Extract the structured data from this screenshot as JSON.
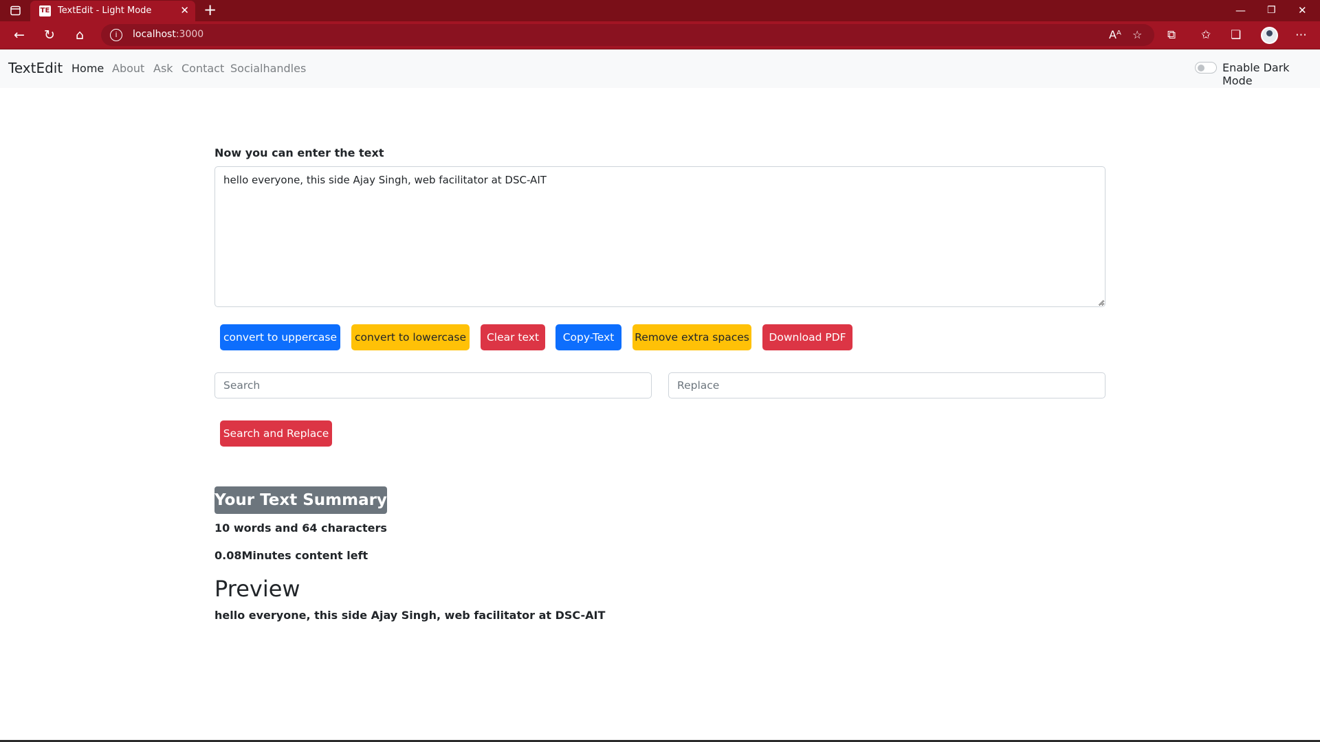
{
  "browser": {
    "tab_title": "TextEdit - Light Mode",
    "favicon_text": "TE",
    "url_host": "localhost",
    "url_port": ":3000"
  },
  "navbar": {
    "brand": "TextEdit",
    "links": [
      "Home",
      "About",
      "Ask",
      "Contact",
      "Socialhandles"
    ],
    "dark_mode_label": "Enable Dark Mode",
    "dark_mode_enabled": false
  },
  "editor": {
    "heading": "Now you can enter the text",
    "text": "hello everyone, this side Ajay Singh, web facilitator at DSC-AIT"
  },
  "actions": {
    "uppercase": "convert to uppercase",
    "lowercase": "convert to lowercase",
    "clear": "Clear text",
    "copy": "Copy-Text",
    "remove_spaces": "Remove extra spaces",
    "download_pdf": "Download PDF"
  },
  "search_replace": {
    "search_placeholder": "Search",
    "replace_placeholder": "Replace",
    "button": "Search and Replace"
  },
  "summary": {
    "heading": "Your Text Summary",
    "word_char_count": "10 words and 64 characters",
    "reading_time": "0.08Minutes content left"
  },
  "preview": {
    "heading": "Preview",
    "text": "hello everyone, this side Ajay Singh, web facilitator at DSC-AIT"
  },
  "colors": {
    "chrome_dark": "#7a0f18",
    "chrome": "#a21524",
    "primary": "#0d6efd",
    "warning": "#ffc107",
    "danger": "#dc3545",
    "secondary": "#6c757d"
  },
  "icons": [
    "sidebar-toggle-icon",
    "close-icon",
    "plus-icon",
    "minimize-icon",
    "restore-icon",
    "back-arrow-icon",
    "refresh-icon",
    "home-icon",
    "info-icon",
    "read-aloud-icon",
    "favorite-add-icon",
    "extensions-icon",
    "favorites-icon",
    "collections-icon",
    "more-icon"
  ]
}
